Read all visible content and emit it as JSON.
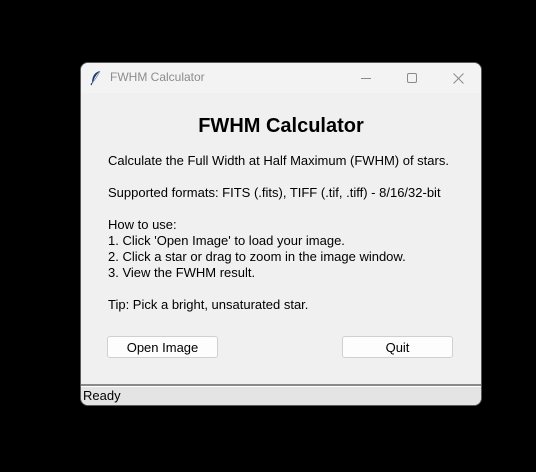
{
  "window": {
    "title": "FWHM Calculator",
    "icon": "feather-icon"
  },
  "main": {
    "heading": "FWHM Calculator",
    "description": "Calculate the Full Width at Half Maximum (FWHM) of stars.",
    "formats": "Supported formats: FITS (.fits), TIFF (.tif, .tiff) - 8/16/32-bit",
    "howto_title": "How to use:",
    "steps": [
      "1. Click 'Open Image' to load your image.",
      "2. Click a star or drag to zoom in the image window.",
      "3. View the FWHM result."
    ],
    "tip": "Tip: Pick a bright, unsaturated star."
  },
  "buttons": {
    "open_label": "Open Image",
    "quit_label": "Quit"
  },
  "status": {
    "text": "Ready"
  }
}
